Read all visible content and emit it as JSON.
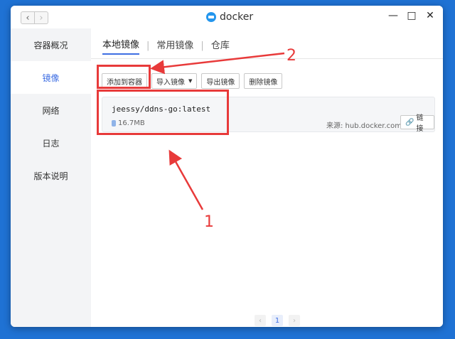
{
  "titlebar": {
    "title": "docker",
    "back": "‹",
    "forward": "›",
    "controls": {
      "minimize": "—",
      "maximize": "□",
      "close": "✕"
    }
  },
  "sidebar": {
    "items": [
      {
        "label": "容器概况",
        "active": false
      },
      {
        "label": "镜像",
        "active": true
      },
      {
        "label": "网络",
        "active": false
      },
      {
        "label": "日志",
        "active": false
      },
      {
        "label": "版本说明",
        "active": false
      }
    ]
  },
  "tabs": [
    {
      "label": "本地镜像",
      "active": true
    },
    {
      "label": "常用镜像",
      "active": false
    },
    {
      "label": "仓库",
      "active": false
    }
  ],
  "toolbar": {
    "add_to_container": "添加到容器",
    "import_image": "导入镜像",
    "export_image": "导出镜像",
    "delete_image": "删除镜像",
    "caret": "▼"
  },
  "image": {
    "name": "jeessy/ddns-go:latest",
    "size": "16.7MB",
    "source": "来源: hub.docker.com",
    "link_label": "链接",
    "link_icon": "🔗"
  },
  "pagination": {
    "prev": "‹",
    "current": "1",
    "next": "›"
  },
  "annotations": {
    "label_1": "1",
    "label_2": "2",
    "color": "#e83a3a"
  },
  "colors": {
    "accent": "#3e6ee3",
    "background": "#1f72d4"
  }
}
